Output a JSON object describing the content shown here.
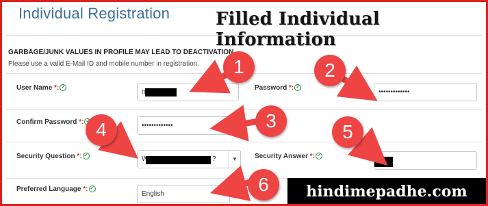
{
  "header": {
    "title": "Individual Registration",
    "overlay_title": "Filled Individual Information"
  },
  "notice": {
    "warning": "GARBAGE/JUNK VALUES IN PROFILE MAY LEAD TO DEACTIVATION",
    "instruction": "Please use a valid E-Mail ID and mobile number in registration."
  },
  "form": {
    "user_name": {
      "label": "User Name",
      "value_prefix": "m"
    },
    "password": {
      "label": "Password",
      "value": "•••••••••••••"
    },
    "confirm_password": {
      "label": "Confirm Password",
      "value": "•••••••••••••"
    },
    "security_question": {
      "label": "Security Question",
      "value_prefix": "W",
      "value_suffix": "?"
    },
    "security_answer": {
      "label": "Security Answer"
    },
    "preferred_language": {
      "label": "Preferred Language",
      "value": "English"
    },
    "required_marker": "*:"
  },
  "annotations": {
    "badges": [
      "1",
      "2",
      "3",
      "4",
      "5",
      "6"
    ],
    "color": "#ee4444"
  },
  "watermark": "hindimepadhe.com"
}
